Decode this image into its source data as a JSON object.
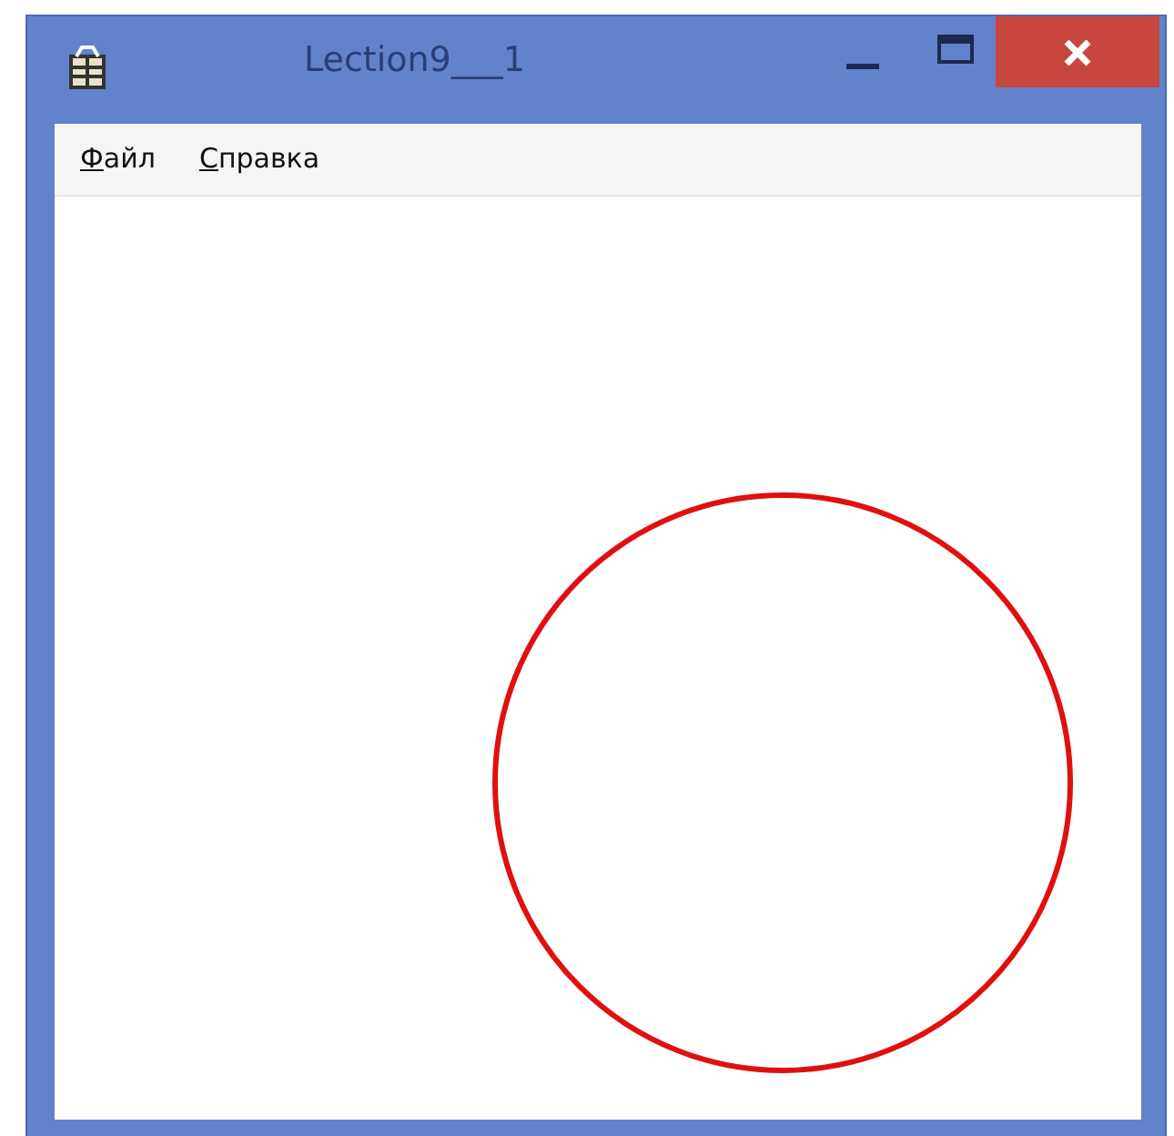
{
  "window": {
    "title": "Lection9___1"
  },
  "menu": [
    {
      "label": "Файл",
      "underline_first": true
    },
    {
      "label": "Справка",
      "underline_first": true
    }
  ],
  "canvas": {
    "shapes": [
      {
        "kind": "circle",
        "color": "#e01010"
      }
    ]
  }
}
